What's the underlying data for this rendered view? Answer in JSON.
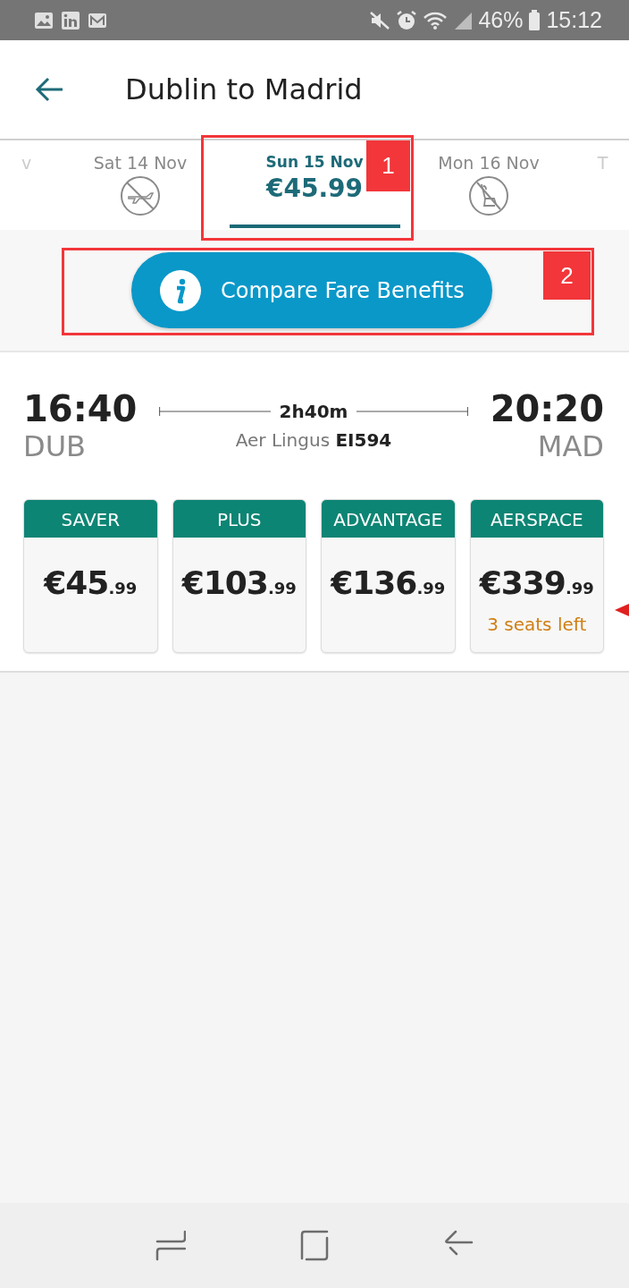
{
  "status_bar": {
    "battery": "46%",
    "time": "15:12"
  },
  "header": {
    "title": "Dublin to Madrid"
  },
  "date_tabs": [
    {
      "label": "v",
      "kind": "partial",
      "selected": false
    },
    {
      "label": "Sat 14 Nov",
      "kind": "no_flights",
      "selected": false
    },
    {
      "label": "Sun 15 Nov",
      "kind": "fare",
      "price": "€45.99",
      "selected": true
    },
    {
      "label": "Mon 16 Nov",
      "kind": "sold_out",
      "selected": false
    },
    {
      "label": "T",
      "kind": "partial",
      "selected": false
    }
  ],
  "compare_button": {
    "label": "Compare Fare Benefits"
  },
  "flight": {
    "depart_time": "16:40",
    "depart_airport": "DUB",
    "duration": "2h40m",
    "carrier": "Aer Lingus **EI594**",
    "arrive_time": "20:20",
    "arrive_airport": "MAD"
  },
  "fares": [
    {
      "name": "SAVER",
      "amount": "€45",
      "cents": ".99"
    },
    {
      "name": "PLUS",
      "amount": "€103",
      "cents": ".99"
    },
    {
      "name": "ADVANTAGE",
      "amount": "€136",
      "cents": ".99"
    },
    {
      "name": "AERSPACE",
      "amount": "€339",
      "cents": ".99",
      "note": "3 seats left"
    }
  ],
  "annotations": [
    {
      "label": "1"
    },
    {
      "label": "2"
    }
  ]
}
